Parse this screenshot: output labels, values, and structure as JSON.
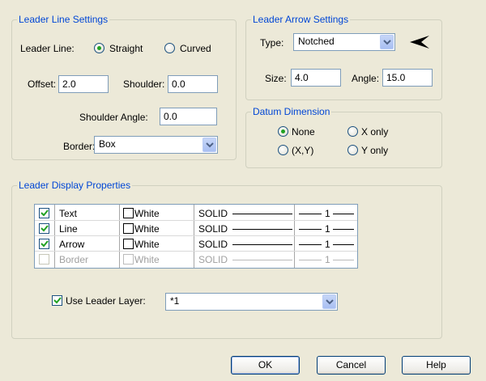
{
  "leader_line_settings": {
    "title": "Leader Line Settings",
    "leader_line_label": "Leader Line:",
    "straight_label": "Straight",
    "curved_label": "Curved",
    "selected": "Straight",
    "offset_label": "Offset:",
    "offset_value": "2.0",
    "shoulder_label": "Shoulder:",
    "shoulder_value": "0.0",
    "shoulder_angle_label": "Shoulder Angle:",
    "shoulder_angle_value": "0.0",
    "border_label": "Border:",
    "border_value": "Box"
  },
  "leader_arrow_settings": {
    "title": "Leader Arrow Settings",
    "type_label": "Type:",
    "type_value": "Notched",
    "preview_icon": "notched-arrow-icon",
    "size_label": "Size:",
    "size_value": "4.0",
    "angle_label": "Angle:",
    "angle_value": "15.0"
  },
  "datum_dimension": {
    "title": "Datum Dimension",
    "none_label": "None",
    "x_only_label": "X only",
    "xy_label": "(X,Y)",
    "y_only_label": "Y only",
    "selected": "None"
  },
  "leader_display_properties": {
    "title": "Leader Display Properties",
    "rows": [
      {
        "checked": true,
        "name": "Text",
        "color": "White",
        "linetype": "SOLID",
        "weight": "1",
        "enabled": true
      },
      {
        "checked": true,
        "name": "Line",
        "color": "White",
        "linetype": "SOLID",
        "weight": "1",
        "enabled": true
      },
      {
        "checked": true,
        "name": "Arrow",
        "color": "White",
        "linetype": "SOLID",
        "weight": "1",
        "enabled": true
      },
      {
        "checked": false,
        "name": "Border",
        "color": "White",
        "linetype": "SOLID",
        "weight": "1",
        "enabled": false
      }
    ],
    "use_leader_layer_label": "Use Leader Layer:",
    "use_leader_layer_checked": true,
    "layer_value": "*1"
  },
  "buttons": {
    "ok": "OK",
    "cancel": "Cancel",
    "help": "Help"
  },
  "colors": {
    "group_title": "#0046d5",
    "dialog_bg": "#ece9d8",
    "checkmark": "#21a121"
  }
}
